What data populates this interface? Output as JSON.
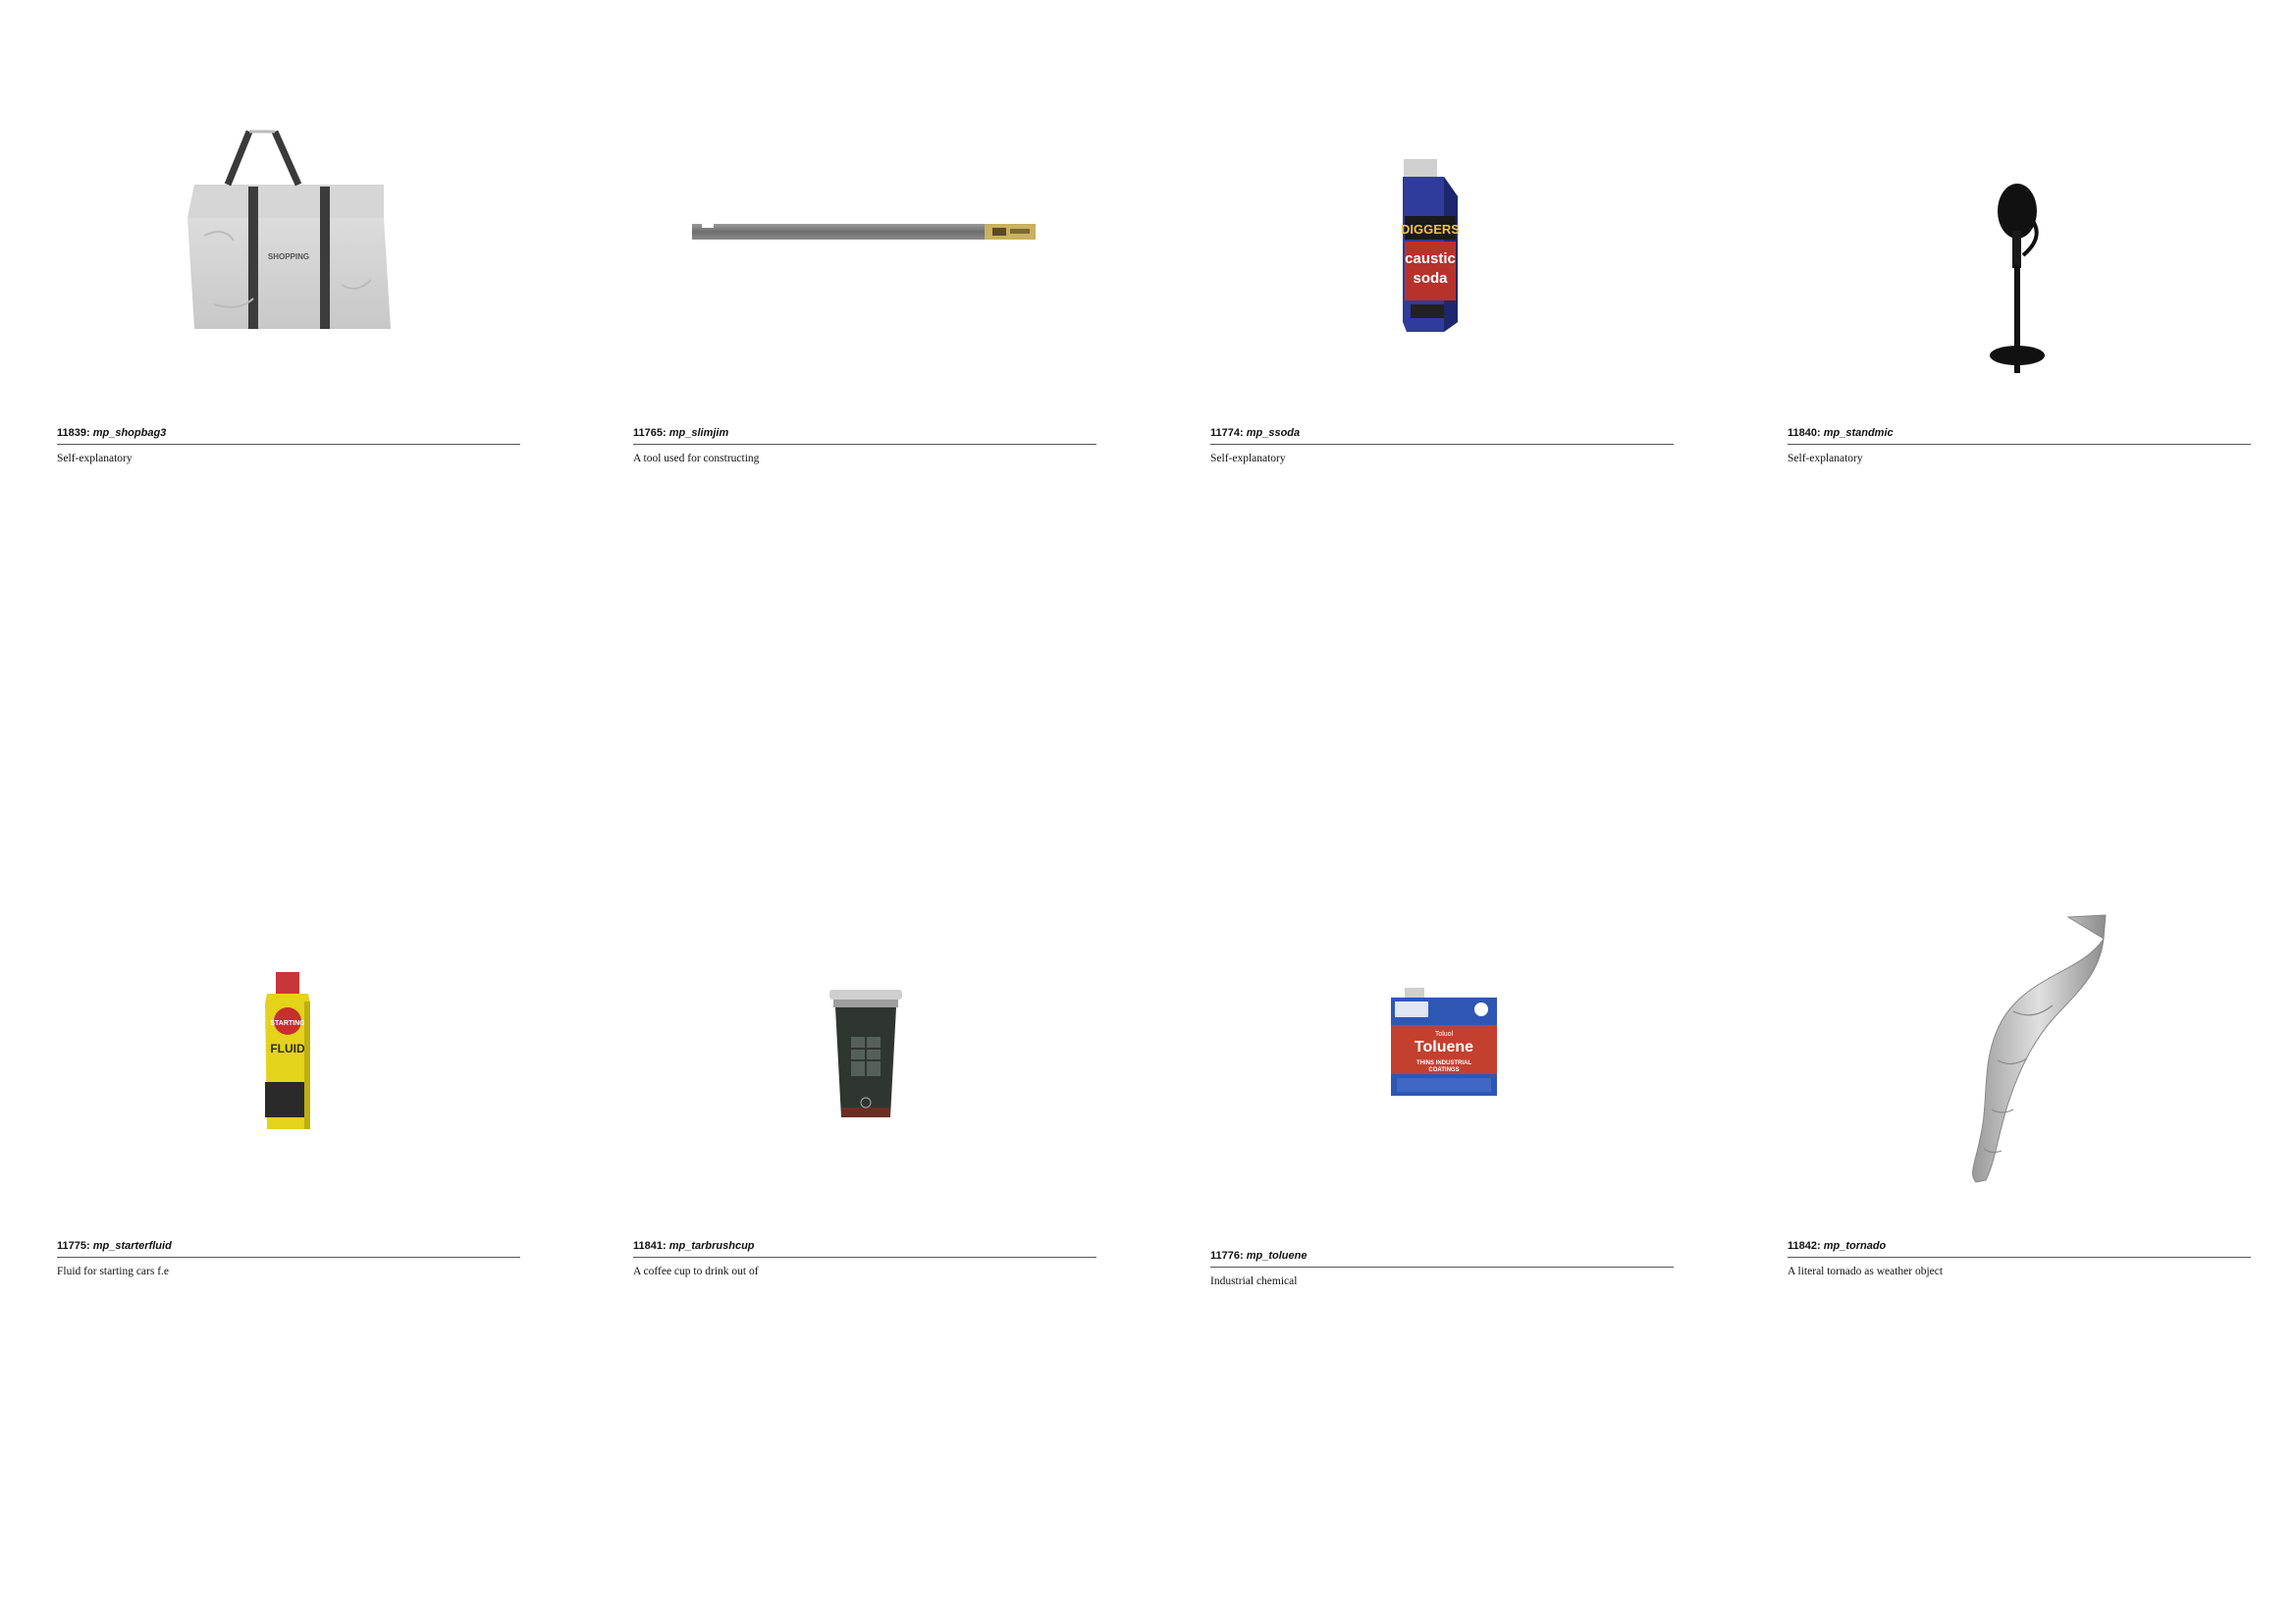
{
  "items": [
    {
      "id": "11839",
      "sep": ": ",
      "name": "mp_shopbag3",
      "description": "Self-explanatory",
      "icon": "shopping-bag-icon",
      "embedded_text": "SHOPPING"
    },
    {
      "id": "11765",
      "sep": ": ",
      "name": "mp_slimjim",
      "description": "A tool used for constructing",
      "icon": "slim-jim-tool-icon"
    },
    {
      "id": "11774",
      "sep": ": ",
      "name": "mp_ssoda",
      "description": "Self-explanatory",
      "icon": "caustic-soda-bottle-icon",
      "embedded_text": "DIGGERS caustic soda"
    },
    {
      "id": "11840",
      "sep": ": ",
      "name": "mp_standmic",
      "description": "Self-explanatory",
      "icon": "standing-microphone-icon"
    },
    {
      "id": "11775",
      "sep": ": ",
      "name": "mp_starterfluid",
      "description": "Fluid for starting cars f.e",
      "icon": "starter-fluid-can-icon",
      "embedded_text": "STARTING FLUID"
    },
    {
      "id": "11841",
      "sep": ": ",
      "name": "mp_tarbrushcup",
      "description": "A coffee cup to drink out of",
      "icon": "coffee-cup-icon"
    },
    {
      "id": "11776",
      "sep": ": ",
      "name": "mp_toluene",
      "description": "Industrial chemical",
      "icon": "toluene-can-icon",
      "embedded_text": "Toluol Toluene THINS INDUSTRIAL COATINGS"
    },
    {
      "id": "11842",
      "sep": ": ",
      "name": "mp_tornado",
      "description": "A literal tornado as weather object",
      "icon": "tornado-icon"
    }
  ]
}
